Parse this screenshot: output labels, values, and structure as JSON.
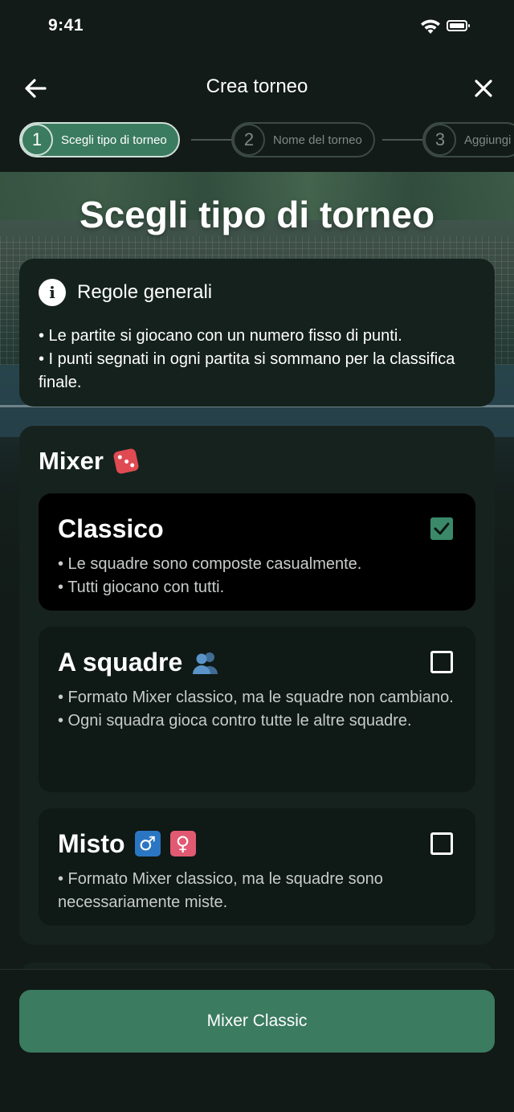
{
  "status_bar": {
    "time": "9:41"
  },
  "header": {
    "title": "Crea torneo"
  },
  "stepper": {
    "steps": [
      {
        "number": "1",
        "label": "Scegli tipo di torneo",
        "active": true
      },
      {
        "number": "2",
        "label": "Nome del torneo",
        "active": false
      },
      {
        "number": "3",
        "label": "Aggiungi",
        "active": false
      }
    ]
  },
  "hero": {
    "title": "Scegli tipo di torneo"
  },
  "info": {
    "title": "Regole generali",
    "rules": [
      "• Le partite si giocano con un numero fisso di punti.",
      "• I punti segnati in ogni partita si sommano per la classifica finale."
    ]
  },
  "mixer": {
    "title": "Mixer",
    "options": [
      {
        "title": "Classico",
        "checked": true,
        "lines": [
          "• Le squadre sono composte casualmente.",
          "• Tutti giocano con tutti."
        ]
      },
      {
        "title": "A squadre",
        "checked": false,
        "lines": [
          "• Formato Mixer classico, ma le squadre non cambiano.",
          "• Ogni squadra gioca contro tutte le altre squadre."
        ]
      },
      {
        "title": "Misto",
        "checked": false,
        "male_symbol": "♂",
        "female_symbol": "♀",
        "lines": [
          "• Formato Mixer classico, ma le squadre sono necessariamente miste."
        ]
      }
    ]
  },
  "footer": {
    "button_label": "Mixer Classic"
  },
  "colors": {
    "accent": "#3b7b60",
    "background": "#121b17",
    "card": "#16221d",
    "selected": "#000000"
  }
}
